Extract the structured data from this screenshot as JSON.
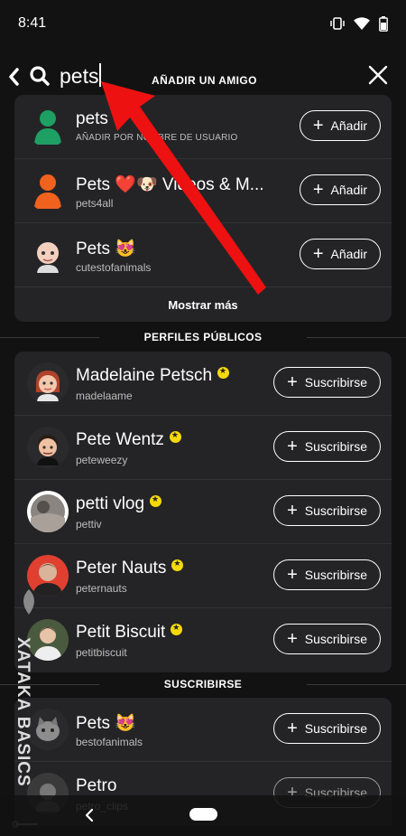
{
  "status_bar": {
    "time": "8:41"
  },
  "search": {
    "query": "pets",
    "header_title": "AÑADIR UN AMIGO"
  },
  "add_friend": {
    "rows": [
      {
        "name": "pets",
        "sub": "AÑADIR POR NOMBRE DE USUARIO",
        "button": "Añadir"
      },
      {
        "name": "Pets ❤️🐶 Videos & M...",
        "sub": "pets4all",
        "button": "Añadir"
      },
      {
        "name": "Pets 😻",
        "sub": "cutestofanimals",
        "button": "Añadir"
      }
    ],
    "show_more": "Mostrar más"
  },
  "public_profiles": {
    "title": "PERFILES PÚBLICOS",
    "rows": [
      {
        "name": "Madelaine Petsch",
        "sub": "madelaame",
        "button": "Suscribirse"
      },
      {
        "name": "Pete Wentz",
        "sub": "peteweezy",
        "button": "Suscribirse"
      },
      {
        "name": "petti vlog",
        "sub": "pettiv",
        "button": "Suscribirse"
      },
      {
        "name": "Peter Nauts",
        "sub": "peternauts",
        "button": "Suscribirse"
      },
      {
        "name": "Petit Biscuit",
        "sub": "petitbiscuit",
        "button": "Suscribirse"
      }
    ]
  },
  "subscribe": {
    "title": "SUSCRIBIRSE",
    "rows": [
      {
        "name": "Pets 😻",
        "sub": "bestofanimals",
        "button": "Suscribirse"
      },
      {
        "name": "Petro",
        "sub": "petro_clips",
        "button": "Suscribirse"
      }
    ]
  },
  "watermark": {
    "text": "XATAKA BASICS"
  },
  "colors": {
    "background": "#121212",
    "card": "#242426",
    "verified": "#f5d90a",
    "arrow": "#ee1111"
  }
}
